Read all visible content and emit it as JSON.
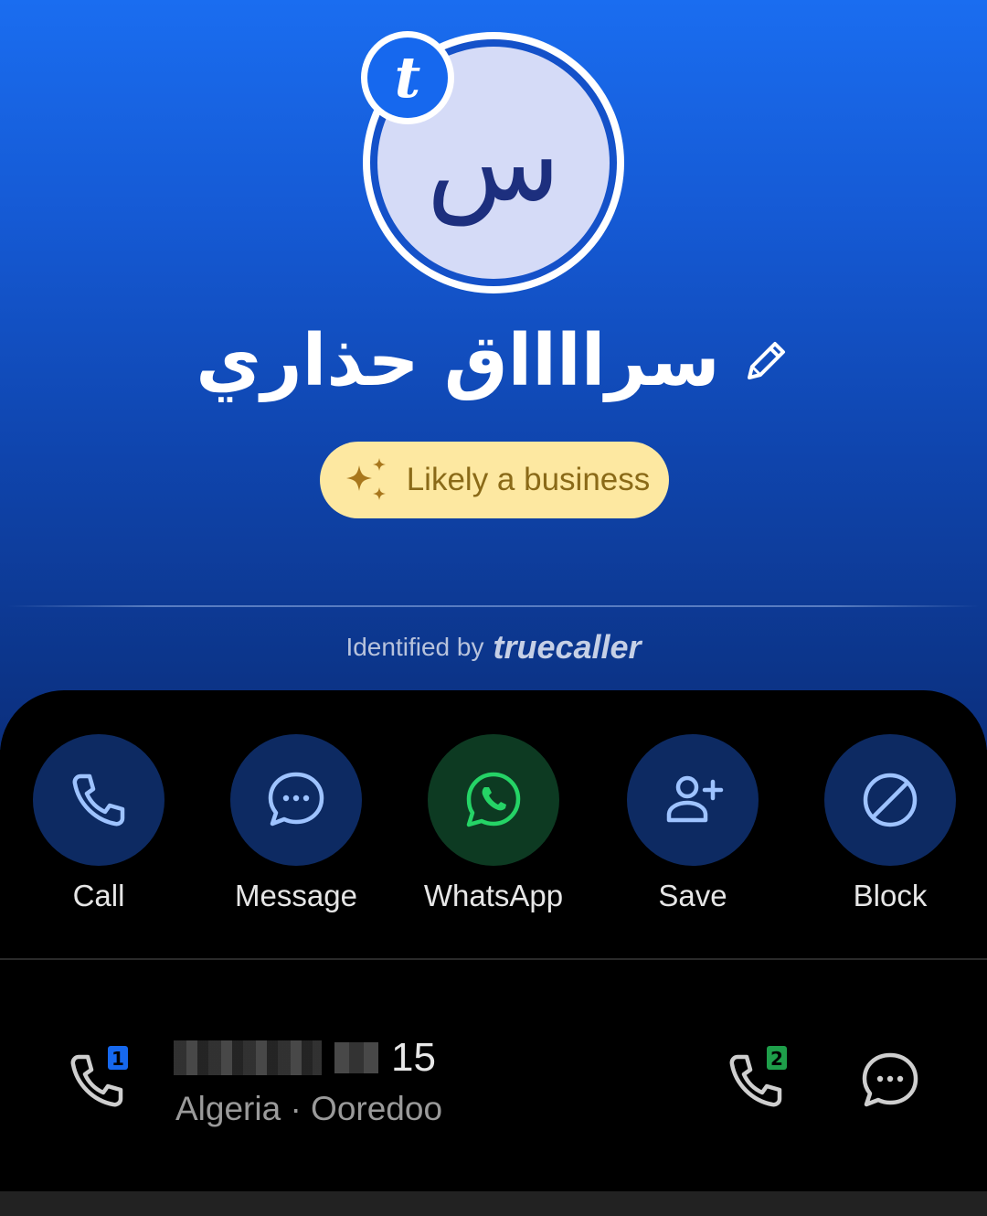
{
  "profile": {
    "avatar_letter": "س",
    "badge_letter": "t",
    "name": "سرااااق حذاري",
    "business_tag": "Likely a business"
  },
  "identified": {
    "label": "Identified by",
    "brand": "truecaller"
  },
  "actions": [
    {
      "label": "Call",
      "icon": "phone-icon"
    },
    {
      "label": "Message",
      "icon": "chat-bubble-icon"
    },
    {
      "label": "WhatsApp",
      "icon": "whatsapp-icon"
    },
    {
      "label": "Save",
      "icon": "add-person-icon"
    },
    {
      "label": "Block",
      "icon": "block-icon"
    }
  ],
  "number": {
    "visible_suffix": "15",
    "carrier": "Algeria · Ooredoo",
    "sim1_label": "1",
    "sim2_label": "2"
  },
  "colors": {
    "accent": "#1668ee",
    "action_bg": "#0d2a62",
    "whatsapp_bg": "#0d3a22",
    "whatsapp_green": "#25d366",
    "business_bg": "#fde8a1",
    "business_gold": "#b07d22",
    "sim1": "#1668ee",
    "sim2": "#1e9e4a"
  }
}
